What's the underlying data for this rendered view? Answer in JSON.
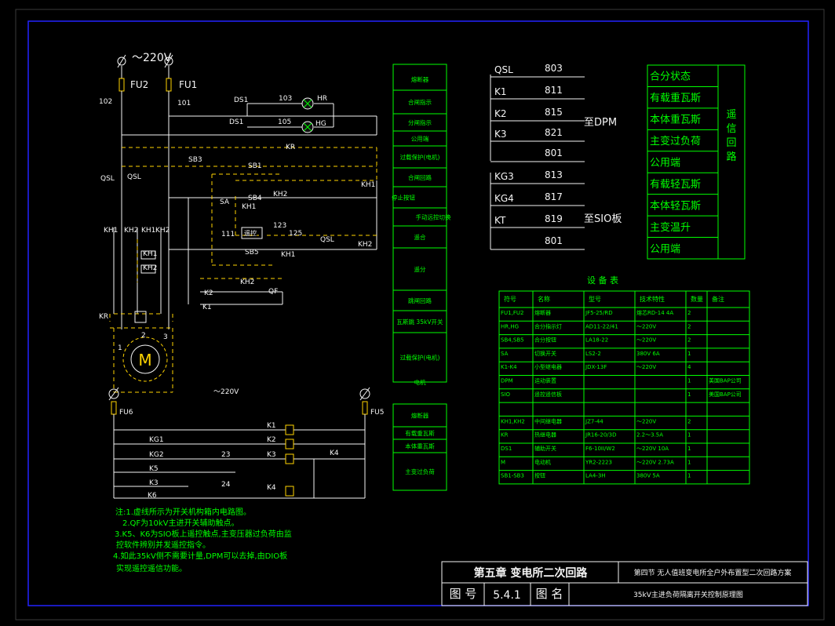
{
  "title_block": {
    "chapter": "第五章  变电所二次回路",
    "section": "第四节  无人值班变电所全户外布置型二次回路方案",
    "drawing_no_label": "图 号",
    "drawing_no": "5.4.1",
    "drawing_name_label": "图 名",
    "drawing_name": "35kV主进负荷隔离开关控制原理图"
  },
  "left_circuit": {
    "supply": "～220V",
    "fu2": "FU2",
    "fu1": "FU1",
    "n102": "102",
    "n101": "101",
    "ds1": "DS1",
    "ds1b": "DS1",
    "n103": "103",
    "n105": "105",
    "hr": "HR",
    "hg": "HG",
    "kr": "KR",
    "sb3": "SB3",
    "sb1": "SB1",
    "sb4": "SB4",
    "sb5": "SB5",
    "sa": "SA",
    "qsl1": "QSL",
    "qsl2": "QSL",
    "qsl3": "QSL",
    "kh1a": "KH1",
    "kh2a": "KH2",
    "kh1b": "KH1",
    "kh2b": "KH2",
    "kh1c": "KH1",
    "kh1d": "KH1",
    "kh2c": "KH2",
    "kh2d": "KH2",
    "kh1e": "KH1",
    "kh2e": "KH2",
    "kh2f": "KH2",
    "n111": "111",
    "remote": "遥控",
    "n123": "123",
    "n125": "125",
    "k2": "K2",
    "k1": "K1",
    "qf": "QF",
    "kr2": "KR",
    "motor": "M",
    "p1": "1",
    "p2": "2",
    "p3": "3"
  },
  "lower_circuit": {
    "supply": "～220V",
    "fu6": "FU6",
    "fu5": "FU5",
    "rows": [
      {
        "left": "KG1",
        "coil": "K1"
      },
      {
        "left": "KG2",
        "coil": "K2"
      },
      {
        "left": "K5",
        "coil": "K3"
      },
      {
        "left": "K3",
        "coil": ""
      },
      {
        "left": "K6",
        "coil": "K4"
      }
    ],
    "k1top": "K1",
    "n23": "23",
    "n24": "24",
    "k4": "K4"
  },
  "function_labels_top": [
    "熔断器",
    "合闸指示",
    "分闸指示",
    "公用端",
    "过载保护(电机)",
    "合闸回路",
    "停止按钮",
    "手动远控切换",
    "遥合",
    "遥分",
    "跳闸回路",
    "瓦斯跳 35kV开关",
    "过载保护(电机)",
    "电机"
  ],
  "function_labels_bottom": [
    "熔断器",
    "有载重瓦斯",
    "本体重瓦斯",
    "主变过负荷"
  ],
  "dpm_group": {
    "top": [
      {
        "name": "QSL",
        "num": "803"
      },
      {
        "name": "K1",
        "num": "811"
      },
      {
        "name": "K2",
        "num": "815"
      },
      {
        "name": "K3",
        "num": "821"
      },
      {
        "name": "",
        "num": "801"
      }
    ],
    "to_dpm": "至DPM",
    "bottom": [
      {
        "name": "KG3",
        "num": "813"
      },
      {
        "name": "KG4",
        "num": "817"
      },
      {
        "name": "KT",
        "num": "819"
      },
      {
        "name": "",
        "num": "801"
      }
    ],
    "to_sio": "至SIO板"
  },
  "signal_table": {
    "items": [
      "合分状态",
      "有载重瓦斯",
      "本体重瓦斯",
      "主变过负荷",
      "公用端",
      "有载轻瓦斯",
      "本体轻瓦斯",
      "主变温升",
      "公用端"
    ],
    "group": "遥信回路"
  },
  "equipment_table": {
    "title": "设 备 表",
    "headers": [
      "符号",
      "名称",
      "型号",
      "技术特性",
      "数量",
      "备注"
    ],
    "rows": [
      [
        "FU1,FU2",
        "熔断器",
        "JF5-25/RD",
        "熔芯RD-14 4A",
        "2",
        ""
      ],
      [
        "HR,HG",
        "合分指示灯",
        "AD11-22/41",
        "～220V",
        "2",
        ""
      ],
      [
        "SB4,SB5",
        "合分按钮",
        "LA18-22",
        "～220V",
        "2",
        ""
      ],
      [
        "SA",
        "切换开关",
        "LS2-2",
        "380V 6A",
        "1",
        ""
      ],
      [
        "K1-K4",
        "小型继电器",
        "JDX-13F",
        "～220V",
        "4",
        ""
      ],
      [
        "DPM",
        "运动装置",
        "",
        "",
        "1",
        "美国BAP公司"
      ],
      [
        "SIO",
        "遥控遥信板",
        "",
        "",
        "1",
        "美国BAP公司"
      ],
      [
        "",
        "",
        "",
        "",
        "",
        ""
      ],
      [
        "KH1,KH2",
        "中间继电器",
        "JZ7-44",
        "～220V",
        "2",
        ""
      ],
      [
        "KR",
        "热继电器",
        "JR16-20/3D",
        "2.2～3.5A",
        "1",
        ""
      ],
      [
        "DS1",
        "辅助开关",
        "F6-10II/W2",
        "～220V 10A",
        "1",
        ""
      ],
      [
        "M",
        "电动机",
        "YR2-2223",
        "～220V 2.73A",
        "1",
        ""
      ],
      [
        "SB1-SB3",
        "按钮",
        "LA4-3H",
        "380V 5A",
        "1",
        ""
      ]
    ]
  },
  "notes": [
    "注:1.虚线所示为开关机构箱内电路图。",
    "2.QF为10kV主进开关辅助触点。",
    "3.K5、K6为SIO板上遥控触点,主变压器过负荷由监",
    "控软件辨别并发遥控指令。",
    "4.如此35kV侧不需要计量,DPM可以去掉,由DIO板",
    "实现遥控遥信功能。"
  ]
}
